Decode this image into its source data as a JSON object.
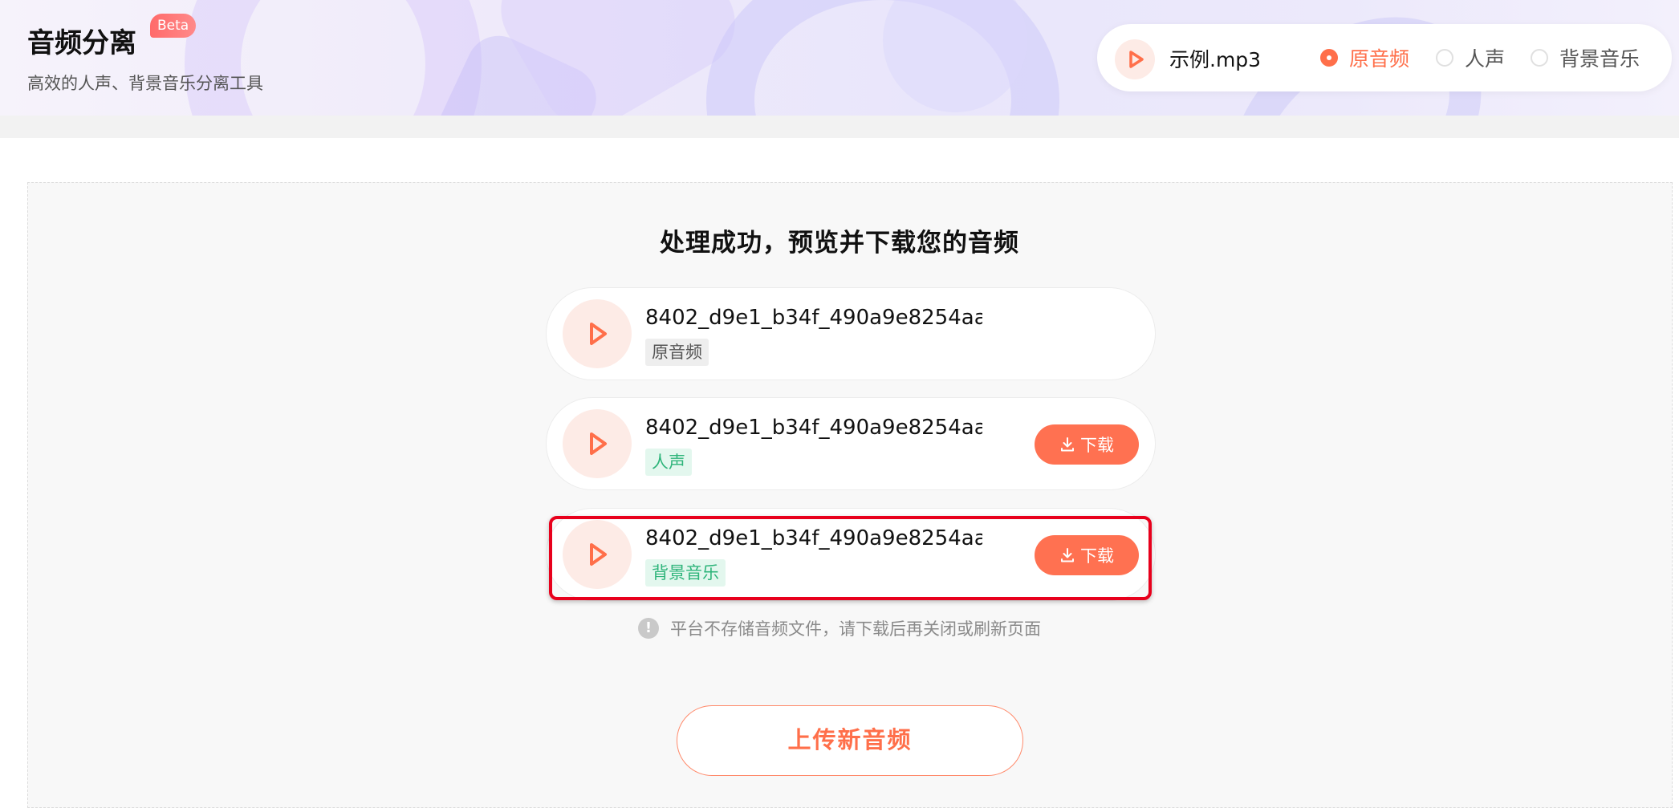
{
  "header": {
    "title": "音频分离",
    "badge": "Beta",
    "subtitle": "高效的人声、背景音乐分离工具"
  },
  "sample": {
    "play_icon": "play-icon",
    "file_name": "示例.mp3",
    "options": [
      {
        "label": "原音频",
        "selected": true
      },
      {
        "label": "人声",
        "selected": false
      },
      {
        "label": "背景音乐",
        "selected": false
      }
    ]
  },
  "result": {
    "heading": "处理成功，预览并下载您的音频",
    "tracks": [
      {
        "file_name": "8402_d9e1_b34f_490a9e8254aa...",
        "tag": "原音频",
        "download": null
      },
      {
        "file_name": "8402_d9e1_b34f_490a9e8254aa...",
        "tag": "人声",
        "download": "下载"
      },
      {
        "file_name": "8402_d9e1_b34f_490a9e8254aa...",
        "tag": "背景音乐",
        "download": "下载"
      }
    ],
    "notice": "平台不存储音频文件，请下载后再关闭或刷新页面",
    "upload_label": "上传新音频"
  },
  "colors": {
    "accent": "#ff7151",
    "tag_green": "#2eb47a",
    "highlight": "#e8001c"
  }
}
